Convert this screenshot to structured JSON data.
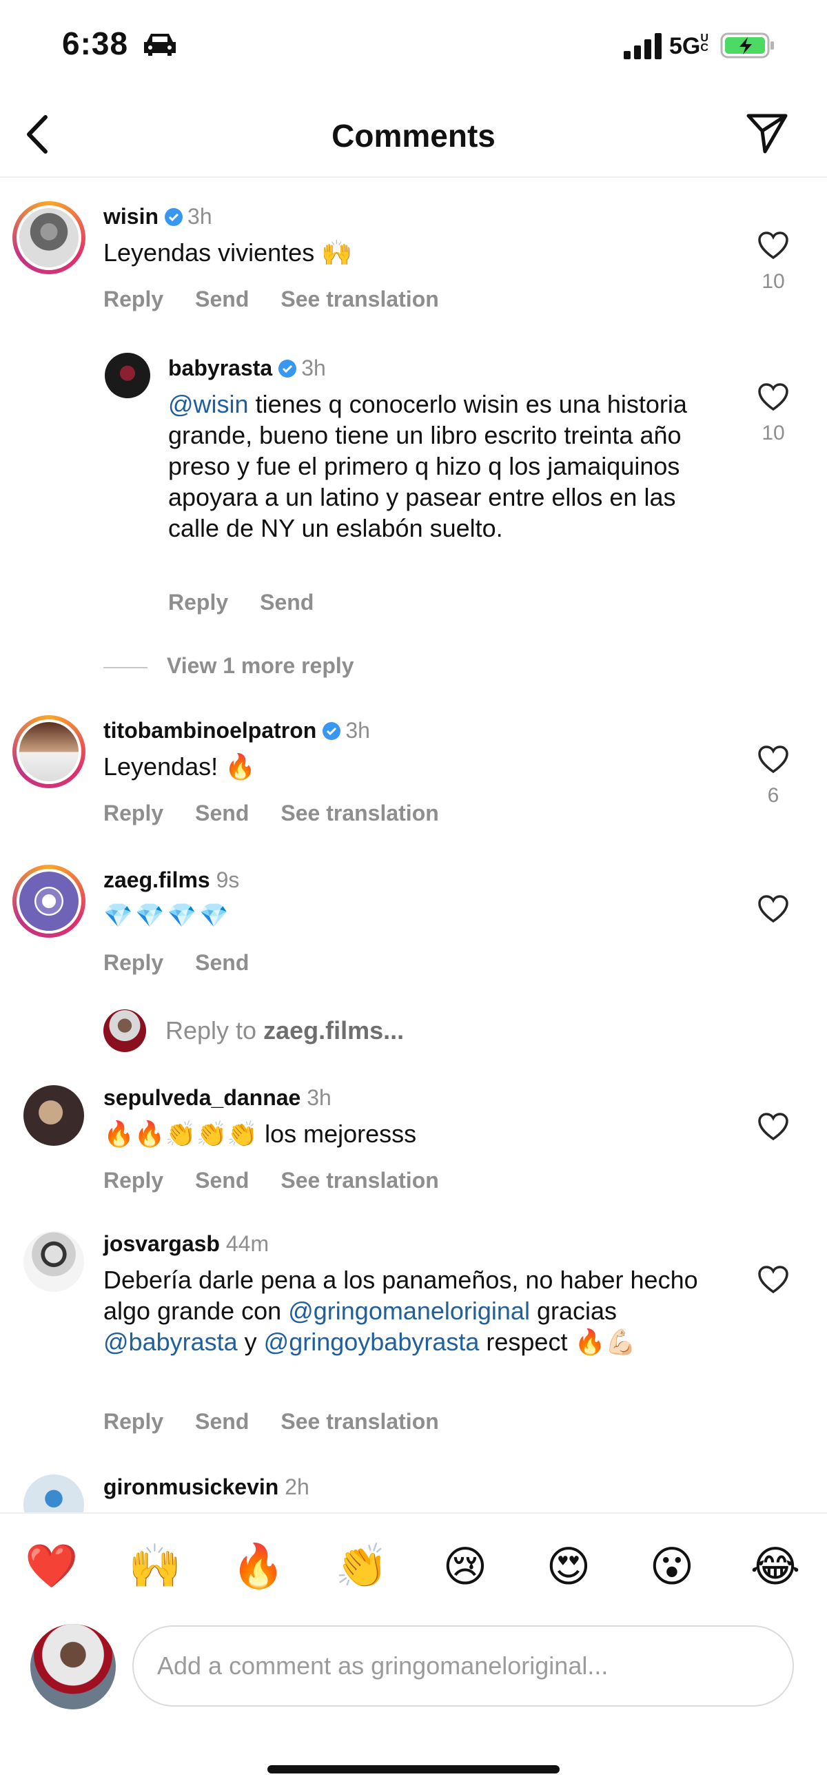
{
  "status_bar": {
    "time": "6:38",
    "network": "5G",
    "network_sub": "UC"
  },
  "header": {
    "title": "Comments"
  },
  "colors": {
    "mention": "#205f9d",
    "verified": "#3897f0",
    "heart_red": "#ed4956",
    "muted": "#8e8e8e"
  },
  "actions": {
    "reply": "Reply",
    "send": "Send",
    "see_translation": "See translation"
  },
  "comments": [
    {
      "username": "wisin",
      "time": "3h",
      "text": "Leyendas vivientes 🙌",
      "likes": "10"
    },
    {
      "username": "babyrasta",
      "time": "3h",
      "mention": "@wisin",
      "text": " tienes q conocerlo wisin es una historia grande, bueno tiene un libro escrito treinta año preso y fue el primero q hizo q los jamaiquinos apoyara a un latino y pasear entre ellos en las calle de NY un eslabón suelto.",
      "likes": "10"
    },
    {
      "username": "titobambinoelpatron",
      "time": "3h",
      "text": "Leyendas! 🔥",
      "likes": "6"
    },
    {
      "username": "zaeg.films",
      "time": "9s",
      "text": "💎💎💎💎"
    },
    {
      "username": "sepulveda_dannae",
      "time": "3h",
      "text": "🔥🔥👏👏👏 los mejoresss"
    },
    {
      "username": "josvargasb",
      "time": "44m",
      "text_1": "Debería darle pena a los panameños, no haber hecho algo grande con ",
      "mention_1": "@gringomaneloriginal",
      "text_2": " gracias ",
      "mention_2": "@babyrasta",
      "text_3": " y ",
      "mention_3": "@gringoybabyrasta",
      "text_4": " respect 🔥💪🏻"
    },
    {
      "username": "gironmusickevin",
      "time": "2h"
    }
  ],
  "view_more": "View 1 more reply",
  "reply_to": {
    "prefix": "Reply to ",
    "target": "zaeg.films..."
  },
  "quick_emojis": [
    "❤️",
    "🙌",
    "🔥",
    "👏",
    "😢",
    "😍",
    "😮",
    "😂"
  ],
  "compose": {
    "placeholder": "Add a comment as gringomaneloriginal..."
  }
}
